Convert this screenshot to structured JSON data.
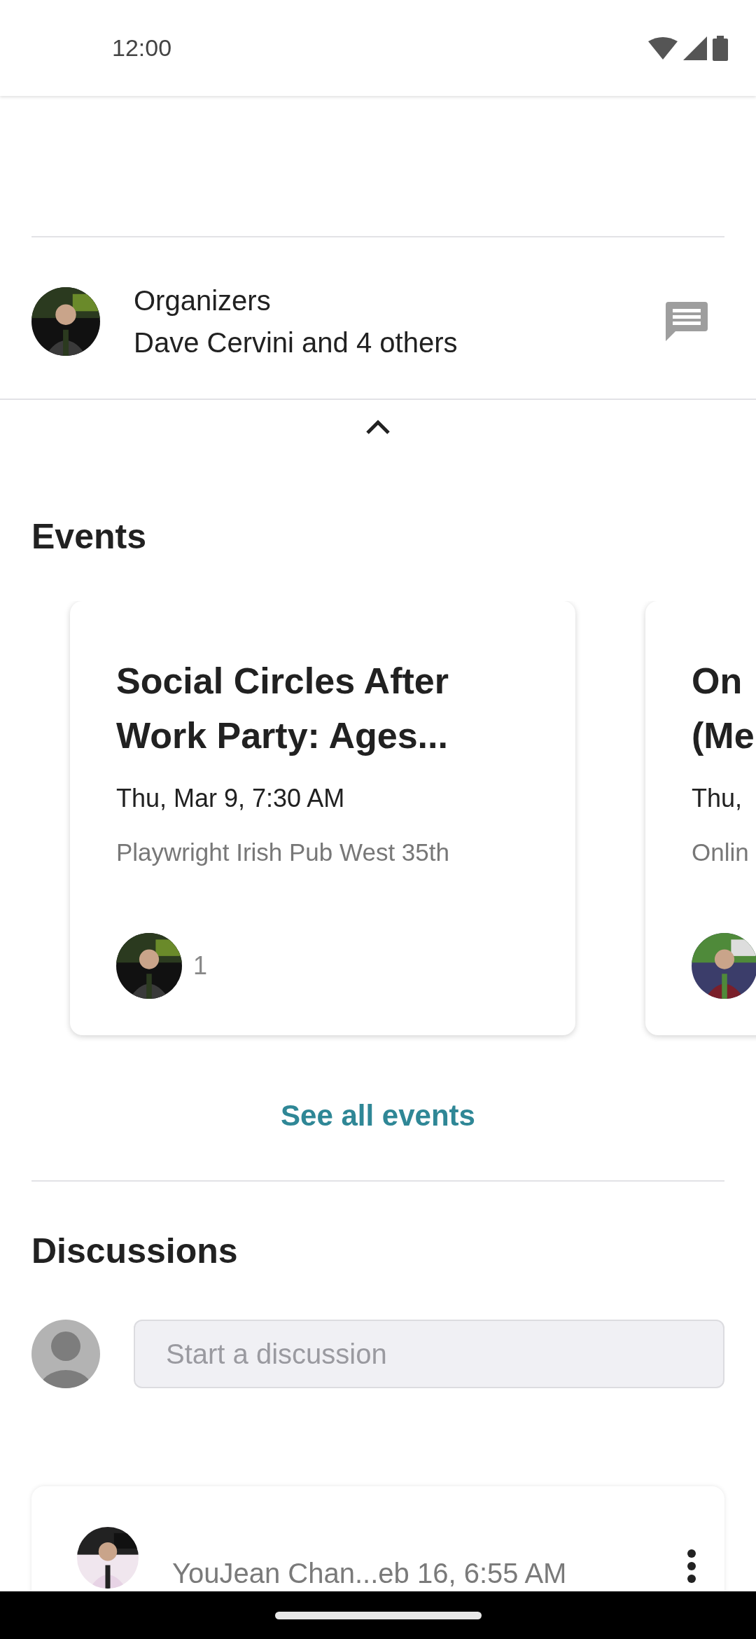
{
  "status_bar": {
    "time": "12:00"
  },
  "organizers": {
    "label": "Organizers",
    "names": "Dave Cervini and 4 others"
  },
  "events": {
    "heading": "Events",
    "cards": [
      {
        "title_lines": [
          "Social Circles After",
          "Work Party: Ages..."
        ],
        "date": "Thu, Mar 9, 7:30 AM",
        "location": "Playwright Irish Pub West 35th",
        "attendee_count": "1"
      },
      {
        "title_lines": [
          "On",
          "(Me"
        ],
        "date": "Thu,",
        "location": "Onlin"
      }
    ],
    "see_all": "See all events"
  },
  "discussions": {
    "heading": "Discussions",
    "input": {
      "placeholder": "Start a discussion"
    },
    "posts": [
      {
        "meta": "YouJean Chan...eb 16, 6:55 AM"
      }
    ]
  }
}
